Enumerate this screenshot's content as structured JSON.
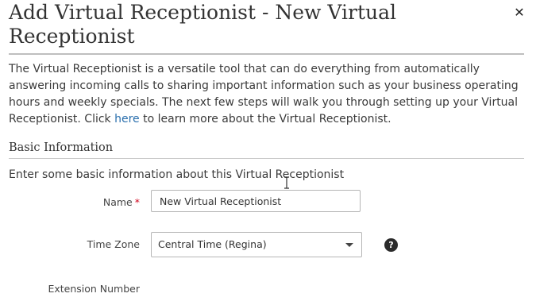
{
  "dialog": {
    "title": "Add Virtual Receptionist - New Virtual Receptionist",
    "close_icon": "close-icon",
    "close_glyph": "✕",
    "intro": {
      "text_before_link": "The Virtual Receptionist is a versatile tool that can do everything from automatically answering incoming calls to sharing important information such as your business operating hours and weekly specials. The next few steps will walk you through setting up your Virtual Receptionist. Click ",
      "link_text": "here",
      "text_after_link": " to learn more about the Virtual Receptionist."
    },
    "section": {
      "title": "Basic Information",
      "description": "Enter some basic information about this Virtual Receptionist"
    },
    "fields": {
      "name": {
        "label": "Name",
        "required_marker": "*",
        "value": "New Virtual Receptionist"
      },
      "time_zone": {
        "label": "Time Zone",
        "selected": "Central Time (Regina)",
        "help_icon": "question-circle-icon",
        "help_glyph": "?"
      },
      "extension_number": {
        "label": "Extension Number"
      }
    }
  },
  "colors": {
    "link": "#2a6fad",
    "required": "#d0021b",
    "rule": "#bfbfbf"
  }
}
